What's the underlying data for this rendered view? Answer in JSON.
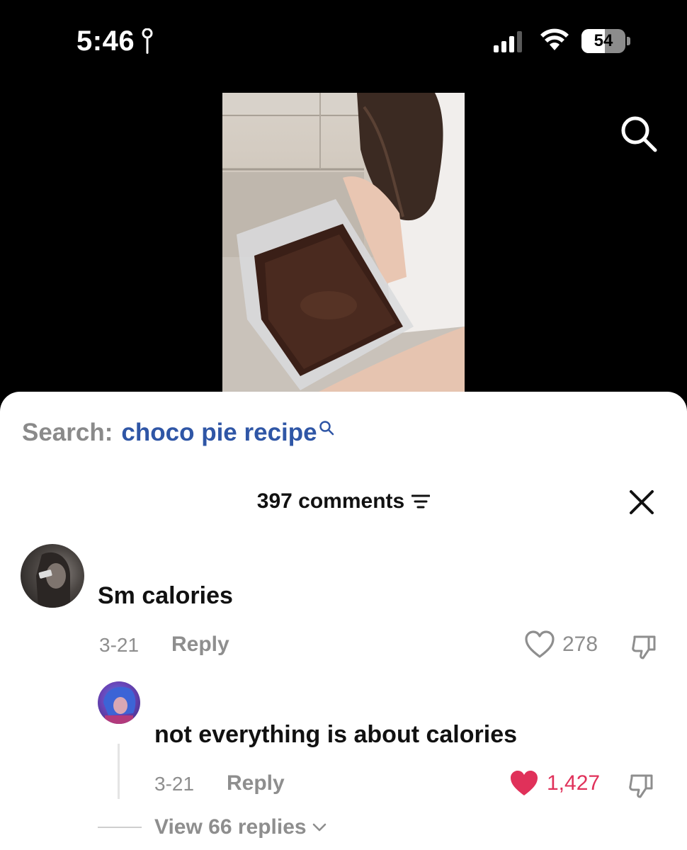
{
  "status_bar": {
    "time": "5:46",
    "battery": "54",
    "battery_level": 0.54
  },
  "video": {
    "search_icon": "search-icon"
  },
  "sheet": {
    "search_prefix": "Search:",
    "search_query": "choco pie recipe",
    "comments_count": "397 comments",
    "close_icon": "close-icon",
    "sort_icon": "sort-icon"
  },
  "comments": [
    {
      "text": "Sm calories",
      "date": "3-21",
      "reply_label": "Reply",
      "likes": "278",
      "liked": false
    },
    {
      "text": "not everything is about calories",
      "date": "3-21",
      "reply_label": "Reply",
      "likes": "1,427",
      "liked": true,
      "view_replies": "View 66 replies"
    }
  ],
  "colors": {
    "link_blue": "#2f56a6",
    "muted_gray": "#8e8e8e",
    "like_red": "#e0315a"
  }
}
